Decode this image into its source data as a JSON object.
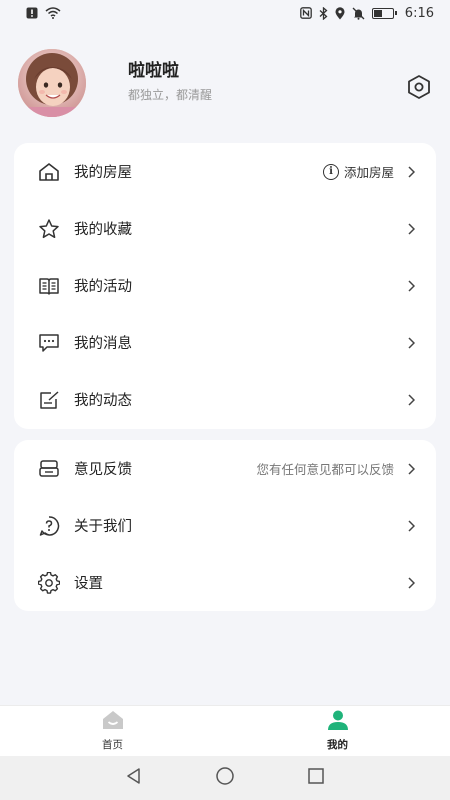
{
  "status_bar": {
    "time": "6:16",
    "icons": [
      "alert-icon",
      "wifi-icon",
      "nfc-icon",
      "bluetooth-icon",
      "location-icon",
      "silent-icon",
      "battery-icon"
    ],
    "battery_level": 0.4
  },
  "profile": {
    "name": "啦啦啦",
    "motto": "都独立，都清醒",
    "settings_icon": "hexagon-settings-icon"
  },
  "menu_primary": [
    {
      "icon": "house-icon",
      "label": "我的房屋",
      "hint": "添加房屋",
      "hint_icon": "info-icon"
    },
    {
      "icon": "star-icon",
      "label": "我的收藏",
      "hint": ""
    },
    {
      "icon": "book-icon",
      "label": "我的活动",
      "hint": ""
    },
    {
      "icon": "message-icon",
      "label": "我的消息",
      "hint": ""
    },
    {
      "icon": "edit-note-icon",
      "label": "我的动态",
      "hint": ""
    }
  ],
  "menu_secondary": [
    {
      "icon": "feedback-icon",
      "label": "意见反馈",
      "hint": "您有任何意见都可以反馈"
    },
    {
      "icon": "question-icon",
      "label": "关于我们",
      "hint": ""
    },
    {
      "icon": "gear-icon",
      "label": "设置",
      "hint": ""
    }
  ],
  "tabs": [
    {
      "icon": "home-tab-icon",
      "label": "首页",
      "active": false
    },
    {
      "icon": "person-tab-icon",
      "label": "我的",
      "active": true
    }
  ],
  "colors": {
    "accent": "#1fb37a",
    "background": "#f4f5f9",
    "card": "#ffffff",
    "inactive_tab": "#c9c9c9"
  }
}
